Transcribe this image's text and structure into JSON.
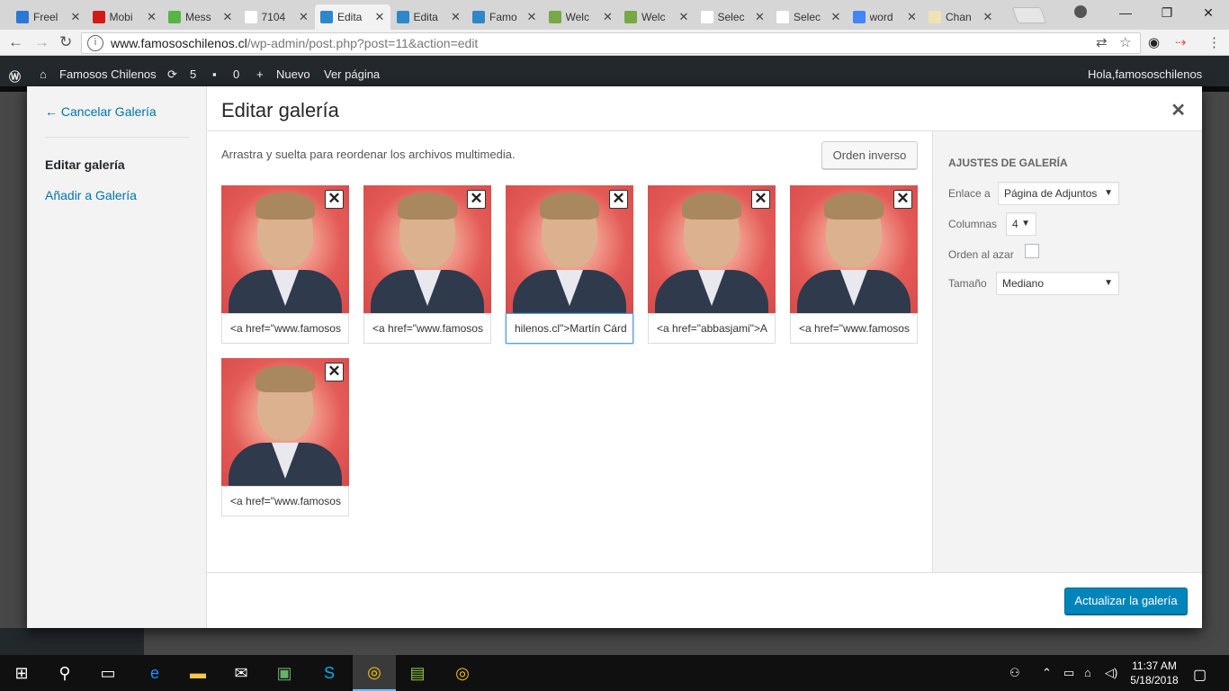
{
  "browser": {
    "tabs": [
      {
        "label": "Freel",
        "color": "#2a77d4"
      },
      {
        "label": "Mobi",
        "color": "#d31a1a"
      },
      {
        "label": "Mess",
        "color": "#57b545"
      },
      {
        "label": "7104",
        "color": "#ffffff"
      },
      {
        "label": "Edita",
        "color": "#2e87c9",
        "active": true
      },
      {
        "label": "Edita",
        "color": "#2e87c9"
      },
      {
        "label": "Famo",
        "color": "#2e87c9"
      },
      {
        "label": "Welc",
        "color": "#78a846"
      },
      {
        "label": "Welc",
        "color": "#78a846"
      },
      {
        "label": "Selec",
        "color": "#ffffff"
      },
      {
        "label": "Selec",
        "color": "#ffffff"
      },
      {
        "label": "word",
        "color": "#4285f4"
      },
      {
        "label": "Chan",
        "color": "#f0e3b3"
      }
    ],
    "url_host": "www.famososchilenos.cl",
    "url_path": "/wp-admin/post.php?post=11&action=edit"
  },
  "adminbar": {
    "site": "Famosos Chilenos",
    "updates": "5",
    "comments": "0",
    "new": "Nuevo",
    "view": "Ver página",
    "greeting": "Hola,famososchilenos"
  },
  "modal": {
    "menu": {
      "cancel": "← Cancelar Galería",
      "current": "Editar galería",
      "add": "Añadir a Galería"
    },
    "title": "Editar galería",
    "instructions": "Arrastra y suelta para reordenar los archivos multimedia.",
    "reverse_button": "Orden inverso",
    "items": [
      {
        "caption": "<a href=\"www.famosos"
      },
      {
        "caption": "<a href=\"www.famosos"
      },
      {
        "caption": "hilenos.cl\">Martín Cárd",
        "focused": true
      },
      {
        "caption": "<a href=\"abbasjami\">A"
      },
      {
        "caption": "<a href=\"www.famosos"
      },
      {
        "caption": "<a href=\"www.famosos"
      }
    ],
    "settings": {
      "heading": "Ajustes de galería",
      "link_label": "Enlace a",
      "link_value": "Página de Adjuntos",
      "columns_label": "Columnas",
      "columns_value": "4",
      "random_label": "Orden al azar",
      "size_label": "Tamaño",
      "size_value": "Mediano"
    },
    "update_button": "Actualizar la galería"
  },
  "taskbar": {
    "time": "11:37 AM",
    "date": "5/18/2018"
  }
}
